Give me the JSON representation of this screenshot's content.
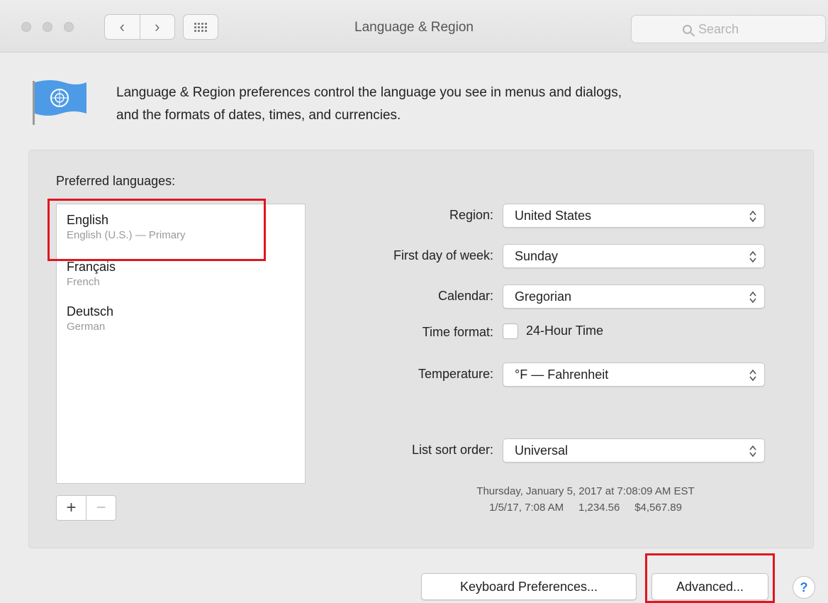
{
  "window": {
    "title": "Language & Region"
  },
  "toolbar": {
    "back_glyph": "‹",
    "forward_glyph": "›",
    "search_placeholder": "Search"
  },
  "header": {
    "icon": "united-nations-flag-icon",
    "description_line1": "Language & Region preferences control the language you see in menus and dialogs,",
    "description_line2": "and the formats of dates, times, and currencies."
  },
  "languages": {
    "label": "Preferred languages:",
    "items": [
      {
        "name": "English",
        "sub": "English (U.S.) — Primary"
      },
      {
        "name": "Français",
        "sub": "French"
      },
      {
        "name": "Deutsch",
        "sub": "German"
      }
    ],
    "add_glyph": "+",
    "remove_glyph": "−"
  },
  "settings": {
    "region": {
      "label": "Region:",
      "value": "United States"
    },
    "first_day": {
      "label": "First day of week:",
      "value": "Sunday"
    },
    "calendar": {
      "label": "Calendar:",
      "value": "Gregorian"
    },
    "time_format": {
      "label": "Time format:",
      "checkbox_label": "24-Hour Time",
      "checked": false
    },
    "temperature": {
      "label": "Temperature:",
      "value": "°F — Fahrenheit"
    },
    "sort_order": {
      "label": "List sort order:",
      "value": "Universal"
    }
  },
  "sample": {
    "line1": "Thursday, January 5, 2017 at 7:08:09 AM EST",
    "line2": "1/5/17, 7:08 AM     1,234.56     $4,567.89"
  },
  "buttons": {
    "keyboard": "Keyboard Preferences...",
    "advanced": "Advanced...",
    "help": "?"
  },
  "colors": {
    "highlight": "#e0161f",
    "help_blue": "#2f7be5"
  }
}
